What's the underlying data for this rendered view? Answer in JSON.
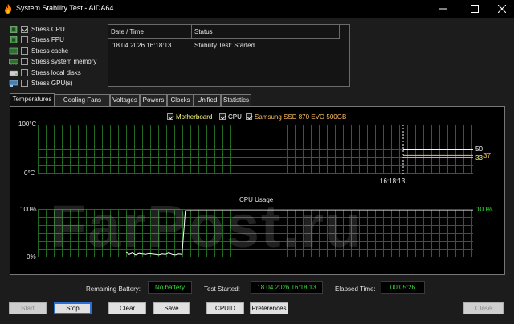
{
  "window": {
    "title": "System Stability Test - AIDA64",
    "icon": "flame-icon"
  },
  "stress_options": [
    {
      "label": "Stress CPU",
      "checked": true,
      "icon": "cpu-icon"
    },
    {
      "label": "Stress FPU",
      "checked": false,
      "icon": "fpu-icon"
    },
    {
      "label": "Stress cache",
      "checked": false,
      "icon": "cache-icon"
    },
    {
      "label": "Stress system memory",
      "checked": false,
      "icon": "memory-icon"
    },
    {
      "label": "Stress local disks",
      "checked": false,
      "icon": "disk-icon"
    },
    {
      "label": "Stress GPU(s)",
      "checked": false,
      "icon": "gpu-icon"
    }
  ],
  "status_table": {
    "columns": [
      "Date / Time",
      "Status"
    ],
    "rows": [
      {
        "datetime": "18.04.2026 16:18:13",
        "status": "Stability Test: Started"
      }
    ]
  },
  "tabs": [
    "Temperatures",
    "Cooling Fans",
    "Voltages",
    "Powers",
    "Clocks",
    "Unified",
    "Statistics"
  ],
  "active_tab": "Temperatures",
  "temperature_legend": [
    {
      "label": "Motherboard",
      "checked": true,
      "color": "#ffff80"
    },
    {
      "label": "CPU",
      "checked": true,
      "color": "#ffffff"
    },
    {
      "label": "Samsung SSD 870 EVO 500GB",
      "checked": true,
      "color": "#ffc060"
    }
  ],
  "chart_data": [
    {
      "type": "line",
      "title": "",
      "y_top_label": "100°C",
      "y_bottom_label": "0°C",
      "ylim": [
        0,
        100
      ],
      "x_marker_label": "16:18:13",
      "grid": true,
      "series": [
        {
          "name": "CPU",
          "color": "#ffffff",
          "values": [
            50
          ],
          "end_label": "50"
        },
        {
          "name": "Motherboard",
          "color": "#ffff80",
          "values": [
            33
          ],
          "end_label": "33"
        },
        {
          "name": "Samsung SSD 870 EVO 500GB",
          "color": "#ffc060",
          "values": [
            37
          ],
          "end_label": "37"
        }
      ]
    },
    {
      "type": "line",
      "title": "CPU Usage",
      "y_top_label": "100%",
      "y_bottom_label": "0%",
      "ylim": [
        0,
        100
      ],
      "grid": true,
      "series": [
        {
          "name": "CPU Usage",
          "color": "#ffffff",
          "values": [
            0,
            0,
            0,
            0,
            0,
            0,
            0,
            0,
            0,
            0,
            0,
            0,
            0,
            0,
            8,
            3,
            6,
            2,
            5,
            4,
            3,
            5,
            4,
            3,
            2,
            4,
            3,
            6,
            3,
            2,
            4,
            3,
            100,
            100,
            100,
            100,
            100,
            100,
            100,
            100,
            100,
            100,
            100,
            100,
            100,
            100,
            100,
            100,
            100,
            100,
            100,
            100,
            100,
            100,
            100,
            100,
            100,
            100,
            100,
            100,
            100,
            100,
            100,
            100,
            100,
            100,
            100,
            100,
            100,
            100,
            100,
            100,
            100,
            100,
            100,
            100,
            100,
            100,
            100,
            100,
            100,
            100,
            100,
            100,
            100,
            100,
            100,
            100,
            100,
            100,
            100,
            100,
            100,
            100,
            100,
            100,
            100,
            100,
            100,
            100,
            100,
            100,
            100,
            100,
            100,
            100,
            100,
            100,
            100,
            100,
            100,
            100,
            100,
            100,
            100,
            100,
            100,
            100,
            100,
            100
          ],
          "end_label": "100%"
        }
      ]
    }
  ],
  "info": {
    "battery_label": "Remaining Battery:",
    "battery_value": "No battery",
    "started_label": "Test Started:",
    "started_value": "18.04.2026 16:18:13",
    "elapsed_label": "Elapsed Time:",
    "elapsed_value": "00:05:26"
  },
  "buttons": {
    "start": "Start",
    "stop": "Stop",
    "clear": "Clear",
    "save": "Save",
    "cpuid": "CPUID",
    "preferences": "Preferences",
    "close": "Close"
  },
  "watermark": "FarPost.ru"
}
